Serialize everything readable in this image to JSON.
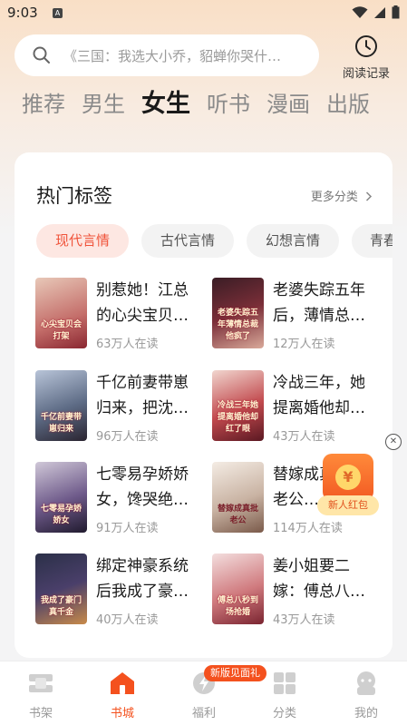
{
  "status": {
    "time": "9:03",
    "app_icon_letter": "A"
  },
  "search": {
    "placeholder": "《三国：我选大小乔，貂蝉你哭什…"
  },
  "history": {
    "label": "阅读记录"
  },
  "tabs": [
    {
      "label": "推荐"
    },
    {
      "label": "男生"
    },
    {
      "label": "女生"
    },
    {
      "label": "听书"
    },
    {
      "label": "漫画"
    },
    {
      "label": "出版"
    }
  ],
  "hot_tags": {
    "title": "热门标签",
    "more": "更多分类",
    "chips": [
      "现代言情",
      "古代言情",
      "幻想言情",
      "青春"
    ]
  },
  "books": [
    {
      "title": "别惹她！江总的心尖宝贝…",
      "reads": "63万人在读",
      "cover_text": "心尖宝贝会打架"
    },
    {
      "title": "老婆失踪五年后，薄情总…",
      "reads": "12万人在读",
      "cover_text": "老婆失踪五年薄情总裁他疯了"
    },
    {
      "title": "千亿前妻带崽归来，把沈…",
      "reads": "96万人在读",
      "cover_text": "千亿前妻带崽归来"
    },
    {
      "title": "冷战三年，她提离婚他却…",
      "reads": "43万人在读",
      "cover_text": "冷战三年她提离婚他却红了眼"
    },
    {
      "title": "七零易孕娇娇女，馋哭绝…",
      "reads": "91万人在读",
      "cover_text": "七零易孕娇娇女"
    },
    {
      "title": "替嫁成真，批老公…",
      "reads": "114万人在读",
      "cover_text": "替嫁成真批老公"
    },
    {
      "title": "绑定神豪系统后我成了豪…",
      "reads": "40万人在读",
      "cover_text": "我成了豪门真千金"
    },
    {
      "title": "姜小姐要二嫁：傅总八…",
      "reads": "43万人在读",
      "cover_text": "傅总八秒到场抢婚"
    }
  ],
  "hongbao": {
    "label": "新人红包",
    "coin": "¥"
  },
  "bottom_nav": {
    "badge": "新版见面礼",
    "items": [
      {
        "label": "书架"
      },
      {
        "label": "书城"
      },
      {
        "label": "福利"
      },
      {
        "label": "分类"
      },
      {
        "label": "我的"
      }
    ]
  },
  "colors": {
    "accent": "#f4511e",
    "chip_active_bg": "#fde7e2",
    "chip_active_text": "#f0533a"
  }
}
